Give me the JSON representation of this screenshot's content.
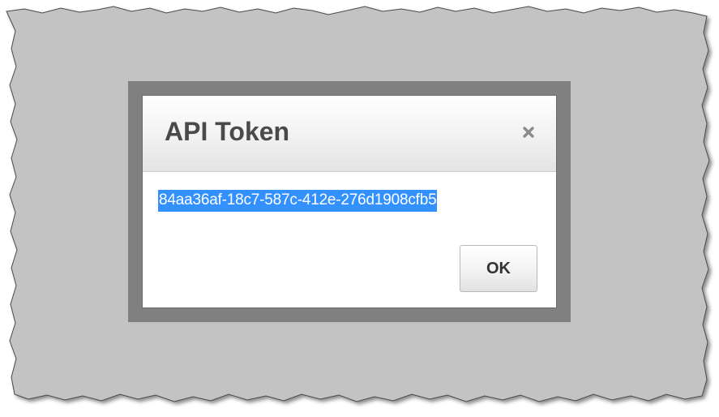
{
  "dialog": {
    "title": "API Token",
    "token": "84aa36af-18c7-587c-412e-276d1908cfb5",
    "ok_label": "OK",
    "close_icon": "close-icon"
  },
  "colors": {
    "backdrop": "#c3c3c3",
    "modal_frame": "#808080",
    "selection": "#3390ff",
    "title_text": "#4a4a4a"
  }
}
